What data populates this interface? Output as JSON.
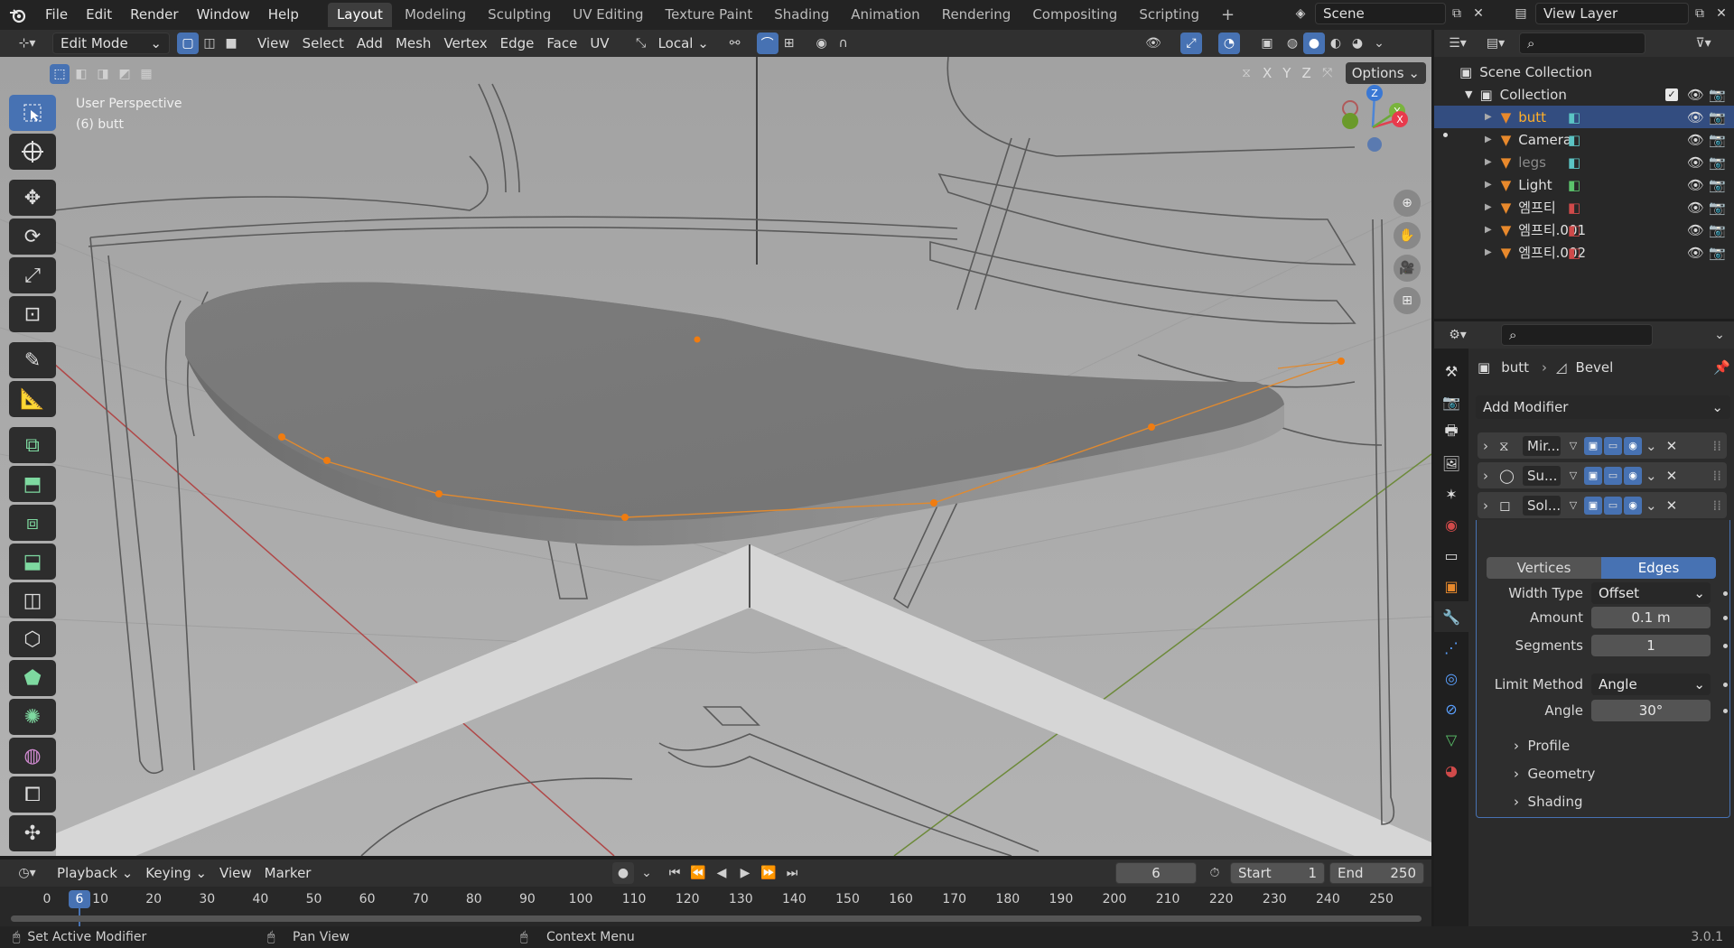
{
  "topbar": {
    "menus": [
      "File",
      "Edit",
      "Render",
      "Window",
      "Help"
    ],
    "workspaces": [
      "Layout",
      "Modeling",
      "Sculpting",
      "UV Editing",
      "Texture Paint",
      "Shading",
      "Animation",
      "Rendering",
      "Compositing",
      "Scripting"
    ],
    "active_workspace": "Layout",
    "scene": "Scene",
    "view_layer": "View Layer"
  },
  "viewport_header": {
    "mode": "Edit Mode",
    "menus": [
      "View",
      "Select",
      "Add",
      "Mesh",
      "Vertex",
      "Edge",
      "Face",
      "UV"
    ],
    "transform_orientation": "Local",
    "options": "Options",
    "axes": [
      "X",
      "Y",
      "Z"
    ]
  },
  "viewport": {
    "perspective": "User Perspective",
    "object_info": "(6) butt",
    "gizmo_axes": [
      "Z",
      "Y",
      "X"
    ]
  },
  "outliner": {
    "root": "Scene Collection",
    "collection": "Collection",
    "items": [
      {
        "name": "butt",
        "selected": true,
        "dim": false
      },
      {
        "name": "Camera",
        "selected": false,
        "dim": false
      },
      {
        "name": "legs",
        "selected": false,
        "dim": true
      },
      {
        "name": "Light",
        "selected": false,
        "dim": false
      },
      {
        "name": "엠프티",
        "selected": false,
        "dim": false
      },
      {
        "name": "엠프티.001",
        "selected": false,
        "dim": false
      },
      {
        "name": "엠프티.002",
        "selected": false,
        "dim": false
      }
    ]
  },
  "properties": {
    "breadcrumb_object": "butt",
    "breadcrumb_modifier": "Bevel",
    "add_modifier": "Add Modifier",
    "modifiers": [
      {
        "name": "Mir...",
        "expanded": false
      },
      {
        "name": "Su...",
        "expanded": false
      },
      {
        "name": "Sol...",
        "expanded": false
      },
      {
        "name": "Bevel",
        "expanded": true
      }
    ],
    "bevel": {
      "affect_vertices": "Vertices",
      "affect_edges": "Edges",
      "width_type_label": "Width Type",
      "width_type": "Offset",
      "amount_label": "Amount",
      "amount": "0.1 m",
      "segments_label": "Segments",
      "segments": "1",
      "limit_method_label": "Limit Method",
      "limit_method": "Angle",
      "angle_label": "Angle",
      "angle": "30°",
      "subpanels": [
        "Profile",
        "Geometry",
        "Shading"
      ]
    }
  },
  "timeline": {
    "menus": [
      "Playback",
      "Keying",
      "View",
      "Marker"
    ],
    "current_frame": "6",
    "start_label": "Start",
    "start": "1",
    "end_label": "End",
    "end": "250",
    "ticks": [
      "0",
      "10",
      "20",
      "30",
      "40",
      "50",
      "60",
      "70",
      "80",
      "90",
      "100",
      "110",
      "120",
      "130",
      "140",
      "150",
      "160",
      "170",
      "180",
      "190",
      "200",
      "210",
      "220",
      "230",
      "240",
      "250"
    ],
    "playhead_label": "6"
  },
  "statusbar": {
    "left": "Set Active Modifier",
    "middle": "Pan View",
    "right": "Context Menu",
    "version": "3.0.1"
  }
}
